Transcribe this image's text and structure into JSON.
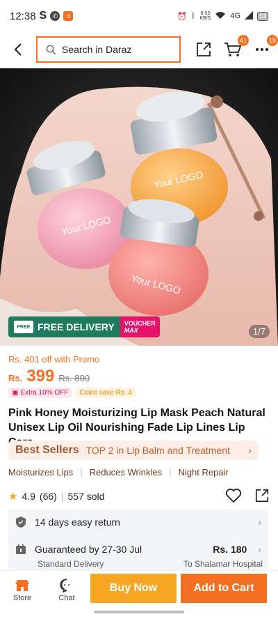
{
  "status_bar": {
    "time": "12:38",
    "s_icon": "S",
    "network_speed_value": "8.03",
    "network_speed_unit": "KB/S",
    "signal": "4G",
    "battery": "13"
  },
  "header": {
    "search_placeholder": "Search in Daraz",
    "cart_count": "41",
    "more_count": "18"
  },
  "hero": {
    "delivery_label": "FREE DELIVERY",
    "free_icon_text": "FREE",
    "voucher_line1": "VOUCHER",
    "voucher_line2": "MAX",
    "image_counter": "1/7",
    "logo_text": "Your LOGO"
  },
  "pricing": {
    "promo": "Rs. 401 off with Promo",
    "currency": "Rs.",
    "price": "399",
    "old_price": "Rs. 800",
    "extra_chip": "Extra 10% OFF",
    "coins_chip": "Coins save Rs. 4"
  },
  "product": {
    "title": "Pink Honey Moisturizing Lip Mask Peach Natural Unisex Lip Oil Nourishing Fade Lip Lines Lip Care"
  },
  "bestseller": {
    "title": "Best Sellers",
    "text": "TOP 2 in Lip Balm and Treatment"
  },
  "features": [
    "Moisturizes Lips",
    "Reduces Wrinkles",
    "Night Repair"
  ],
  "rating": {
    "score": "4.9",
    "reviews": "(66)",
    "sold": "557 sold"
  },
  "info": {
    "return_text": "14 days easy return",
    "guarantee_text": "Guaranteed by 27-30 Jul",
    "shipping_price": "Rs. 180",
    "delivery_type": "Standard Delivery",
    "destination": "To Shalamar Hospital"
  },
  "bottom": {
    "store_label": "Store",
    "chat_label": "Chat",
    "buy_now": "Buy Now",
    "add_to_cart": "Add to Cart"
  },
  "colors": {
    "brand": "#f36f21",
    "buy_now": "#f5a623",
    "delivery_green": "#1e7b5e",
    "voucher_pink": "#e7126c"
  }
}
